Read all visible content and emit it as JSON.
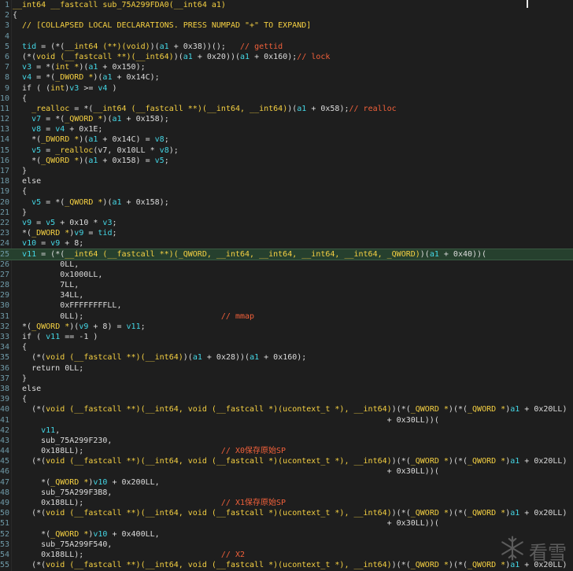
{
  "watermark": {
    "text": "看雪",
    "icon": "snowflake-icon"
  },
  "lines": [
    {
      "n": "1",
      "segs": [
        [
          "k",
          "__int64 __fastcall sub_75A299FDA0(__int64 a1)"
        ]
      ]
    },
    {
      "n": "2",
      "segs": [
        [
          "t",
          "{"
        ]
      ]
    },
    {
      "n": "3",
      "segs": [
        [
          "k",
          "  // [COLLAPSED LOCAL DECLARATIONS. PRESS NUMPAD \"+\" TO EXPAND]"
        ]
      ]
    },
    {
      "n": "4",
      "segs": [
        [
          "t",
          ""
        ]
      ]
    },
    {
      "n": "5",
      "segs": [
        [
          "t",
          "  "
        ],
        [
          "v",
          "tid"
        ],
        [
          "t",
          " = (*("
        ],
        [
          "k",
          "__int64 (**)(void)"
        ],
        [
          "t",
          ")("
        ],
        [
          "v",
          "a1"
        ],
        [
          "t",
          " + 0x38))();   "
        ],
        [
          "c",
          "// gettid"
        ]
      ]
    },
    {
      "n": "6",
      "segs": [
        [
          "t",
          "  (*("
        ],
        [
          "k",
          "void (__fastcall **)(__int64)"
        ],
        [
          "t",
          ")("
        ],
        [
          "v",
          "a1"
        ],
        [
          "t",
          " + 0x20))("
        ],
        [
          "v",
          "a1"
        ],
        [
          "t",
          " + 0x160);"
        ],
        [
          "c",
          "// lock"
        ]
      ]
    },
    {
      "n": "7",
      "segs": [
        [
          "t",
          "  "
        ],
        [
          "v",
          "v3"
        ],
        [
          "t",
          " = *("
        ],
        [
          "k",
          "int *"
        ],
        [
          "t",
          ")("
        ],
        [
          "v",
          "a1"
        ],
        [
          "t",
          " + 0x150);"
        ]
      ]
    },
    {
      "n": "8",
      "segs": [
        [
          "t",
          "  "
        ],
        [
          "v",
          "v4"
        ],
        [
          "t",
          " = *("
        ],
        [
          "k",
          "_DWORD *"
        ],
        [
          "t",
          ")("
        ],
        [
          "v",
          "a1"
        ],
        [
          "t",
          " + 0x14C);"
        ]
      ]
    },
    {
      "n": "9",
      "segs": [
        [
          "t",
          "  if ( ("
        ],
        [
          "k",
          "int"
        ],
        [
          "t",
          ")"
        ],
        [
          "v",
          "v3"
        ],
        [
          "t",
          " >= "
        ],
        [
          "v",
          "v4"
        ],
        [
          "t",
          " )"
        ]
      ]
    },
    {
      "n": "10",
      "segs": [
        [
          "t",
          "  {"
        ]
      ]
    },
    {
      "n": "11",
      "segs": [
        [
          "t",
          "    "
        ],
        [
          "k",
          "_realloc"
        ],
        [
          "t",
          " = *("
        ],
        [
          "k",
          "__int64 (__fastcall **)(__int64, __int64)"
        ],
        [
          "t",
          ")("
        ],
        [
          "v",
          "a1"
        ],
        [
          "t",
          " + 0x58);"
        ],
        [
          "c",
          "// realloc"
        ]
      ]
    },
    {
      "n": "12",
      "segs": [
        [
          "t",
          "    "
        ],
        [
          "v",
          "v7"
        ],
        [
          "t",
          " = *("
        ],
        [
          "k",
          "_QWORD *"
        ],
        [
          "t",
          ")("
        ],
        [
          "v",
          "a1"
        ],
        [
          "t",
          " + 0x158);"
        ]
      ]
    },
    {
      "n": "13",
      "segs": [
        [
          "t",
          "    "
        ],
        [
          "v",
          "v8"
        ],
        [
          "t",
          " = "
        ],
        [
          "v",
          "v4"
        ],
        [
          "t",
          " + 0x1E;"
        ]
      ]
    },
    {
      "n": "14",
      "segs": [
        [
          "t",
          "    *("
        ],
        [
          "k",
          "_DWORD *"
        ],
        [
          "t",
          ")("
        ],
        [
          "v",
          "a1"
        ],
        [
          "t",
          " + 0x14C) = "
        ],
        [
          "v",
          "v8"
        ],
        [
          "t",
          ";"
        ]
      ]
    },
    {
      "n": "15",
      "segs": [
        [
          "t",
          "    "
        ],
        [
          "v",
          "v5"
        ],
        [
          "t",
          " = "
        ],
        [
          "k",
          "_realloc"
        ],
        [
          "t",
          "(v7, 0x10LL * "
        ],
        [
          "v",
          "v8"
        ],
        [
          "t",
          ");"
        ]
      ]
    },
    {
      "n": "16",
      "segs": [
        [
          "t",
          "    *("
        ],
        [
          "k",
          "_QWORD *"
        ],
        [
          "t",
          ")("
        ],
        [
          "v",
          "a1"
        ],
        [
          "t",
          " + 0x158) = "
        ],
        [
          "v",
          "v5"
        ],
        [
          "t",
          ";"
        ]
      ]
    },
    {
      "n": "17",
      "segs": [
        [
          "t",
          "  }"
        ]
      ]
    },
    {
      "n": "18",
      "segs": [
        [
          "t",
          "  else"
        ]
      ]
    },
    {
      "n": "19",
      "segs": [
        [
          "t",
          "  {"
        ]
      ]
    },
    {
      "n": "20",
      "segs": [
        [
          "t",
          "    "
        ],
        [
          "v",
          "v5"
        ],
        [
          "t",
          " = *("
        ],
        [
          "k",
          "_QWORD *"
        ],
        [
          "t",
          ")("
        ],
        [
          "v",
          "a1"
        ],
        [
          "t",
          " + 0x158);"
        ]
      ]
    },
    {
      "n": "21",
      "segs": [
        [
          "t",
          "  }"
        ]
      ]
    },
    {
      "n": "22",
      "segs": [
        [
          "t",
          "  "
        ],
        [
          "v",
          "v9"
        ],
        [
          "t",
          " = "
        ],
        [
          "v",
          "v5"
        ],
        [
          "t",
          " + 0x10 * "
        ],
        [
          "v",
          "v3"
        ],
        [
          "t",
          ";"
        ]
      ]
    },
    {
      "n": "23",
      "segs": [
        [
          "t",
          "  *("
        ],
        [
          "k",
          "_DWORD *"
        ],
        [
          "t",
          ")"
        ],
        [
          "v",
          "v9"
        ],
        [
          "t",
          " = "
        ],
        [
          "v",
          "tid"
        ],
        [
          "t",
          ";"
        ]
      ]
    },
    {
      "n": "24",
      "segs": [
        [
          "t",
          "  "
        ],
        [
          "v",
          "v10"
        ],
        [
          "t",
          " = "
        ],
        [
          "v",
          "v9"
        ],
        [
          "t",
          " + 8;"
        ]
      ]
    },
    {
      "n": "25",
      "hl": true,
      "segs": [
        [
          "t",
          "  "
        ],
        [
          "v",
          "v11"
        ],
        [
          "t",
          " = (*("
        ],
        [
          "k",
          "__int64 (__fastcall **)(_QWORD, __int64, __int64, __int64, __int64, _QWORD)"
        ],
        [
          "t",
          ")("
        ],
        [
          "v",
          "a1"
        ],
        [
          "t",
          " + 0x40))("
        ]
      ]
    },
    {
      "n": "26",
      "segs": [
        [
          "t",
          "          0LL,"
        ]
      ]
    },
    {
      "n": "27",
      "segs": [
        [
          "t",
          "          0x1000LL,"
        ]
      ]
    },
    {
      "n": "28",
      "segs": [
        [
          "t",
          "          7LL,"
        ]
      ]
    },
    {
      "n": "29",
      "segs": [
        [
          "t",
          "          34LL,"
        ]
      ]
    },
    {
      "n": "30",
      "segs": [
        [
          "t",
          "          0xFFFFFFFFLL,"
        ]
      ]
    },
    {
      "n": "31",
      "segs": [
        [
          "t",
          "          0LL);                             "
        ],
        [
          "c",
          "// mmap"
        ]
      ]
    },
    {
      "n": "32",
      "segs": [
        [
          "t",
          "  *("
        ],
        [
          "k",
          "_QWORD *"
        ],
        [
          "t",
          ")("
        ],
        [
          "v",
          "v9"
        ],
        [
          "t",
          " + 8) = "
        ],
        [
          "v",
          "v11"
        ],
        [
          "t",
          ";"
        ]
      ]
    },
    {
      "n": "33",
      "segs": [
        [
          "t",
          "  if ( "
        ],
        [
          "v",
          "v11"
        ],
        [
          "t",
          " == -1 )"
        ]
      ]
    },
    {
      "n": "34",
      "segs": [
        [
          "t",
          "  {"
        ]
      ]
    },
    {
      "n": "35",
      "segs": [
        [
          "t",
          "    (*("
        ],
        [
          "k",
          "void (__fastcall **)(__int64)"
        ],
        [
          "t",
          ")("
        ],
        [
          "v",
          "a1"
        ],
        [
          "t",
          " + 0x28))("
        ],
        [
          "v",
          "a1"
        ],
        [
          "t",
          " + 0x160);"
        ]
      ]
    },
    {
      "n": "36",
      "segs": [
        [
          "t",
          "    return 0LL;"
        ]
      ]
    },
    {
      "n": "37",
      "segs": [
        [
          "t",
          "  }"
        ]
      ]
    },
    {
      "n": "38",
      "segs": [
        [
          "t",
          "  else"
        ]
      ]
    },
    {
      "n": "39",
      "segs": [
        [
          "t",
          "  {"
        ]
      ]
    },
    {
      "n": "40",
      "segs": [
        [
          "t",
          "    (*("
        ],
        [
          "k",
          "void (__fastcall **)(__int64, void (__fastcall *)(ucontext_t *), __int64)"
        ],
        [
          "t",
          ")(*("
        ],
        [
          "k",
          "_QWORD *"
        ],
        [
          "t",
          ")(*("
        ],
        [
          "k",
          "_QWORD *"
        ],
        [
          "t",
          ")"
        ],
        [
          "v",
          "a1"
        ],
        [
          "t",
          " + 0x20LL)"
        ]
      ]
    },
    {
      "n": "41",
      "segs": [
        [
          "t",
          "                                                                               + 0x30LL))("
        ]
      ]
    },
    {
      "n": "42",
      "segs": [
        [
          "t",
          "      "
        ],
        [
          "v",
          "v11"
        ],
        [
          "t",
          ","
        ]
      ]
    },
    {
      "n": "43",
      "segs": [
        [
          "t",
          "      sub_75A299F230,"
        ]
      ]
    },
    {
      "n": "44",
      "segs": [
        [
          "t",
          "      0x188LL);                             "
        ],
        [
          "c",
          "// X0保存原始SP"
        ]
      ]
    },
    {
      "n": "45",
      "segs": [
        [
          "t",
          "    (*("
        ],
        [
          "k",
          "void (__fastcall **)(__int64, void (__fastcall *)(ucontext_t *), __int64)"
        ],
        [
          "t",
          ")(*("
        ],
        [
          "k",
          "_QWORD *"
        ],
        [
          "t",
          ")(*("
        ],
        [
          "k",
          "_QWORD *"
        ],
        [
          "t",
          ")"
        ],
        [
          "v",
          "a1"
        ],
        [
          "t",
          " + 0x20LL)"
        ]
      ]
    },
    {
      "n": "46",
      "segs": [
        [
          "t",
          "                                                                               + 0x30LL))("
        ]
      ]
    },
    {
      "n": "47",
      "segs": [
        [
          "t",
          "      *("
        ],
        [
          "k",
          "_QWORD *"
        ],
        [
          "t",
          ")"
        ],
        [
          "v",
          "v10"
        ],
        [
          "t",
          " + 0x200LL,"
        ]
      ]
    },
    {
      "n": "48",
      "segs": [
        [
          "t",
          "      sub_75A299F3B8,"
        ]
      ]
    },
    {
      "n": "49",
      "segs": [
        [
          "t",
          "      0x188LL);                             "
        ],
        [
          "c",
          "// X1保存原始SP"
        ]
      ]
    },
    {
      "n": "50",
      "segs": [
        [
          "t",
          "    (*("
        ],
        [
          "k",
          "void (__fastcall **)(__int64, void (__fastcall *)(ucontext_t *), __int64)"
        ],
        [
          "t",
          ")(*("
        ],
        [
          "k",
          "_QWORD *"
        ],
        [
          "t",
          ")(*("
        ],
        [
          "k",
          "_QWORD *"
        ],
        [
          "t",
          ")"
        ],
        [
          "v",
          "a1"
        ],
        [
          "t",
          " + 0x20LL)"
        ]
      ]
    },
    {
      "n": "51",
      "segs": [
        [
          "t",
          "                                                                               + 0x30LL))("
        ]
      ]
    },
    {
      "n": "52",
      "segs": [
        [
          "t",
          "      *("
        ],
        [
          "k",
          "_QWORD *"
        ],
        [
          "t",
          ")"
        ],
        [
          "v",
          "v10"
        ],
        [
          "t",
          " + 0x400LL,"
        ]
      ]
    },
    {
      "n": "53",
      "segs": [
        [
          "t",
          "      sub_75A299F540,"
        ]
      ]
    },
    {
      "n": "54",
      "segs": [
        [
          "t",
          "      0x188LL);                             "
        ],
        [
          "c",
          "// X2"
        ]
      ]
    },
    {
      "n": "55",
      "segs": [
        [
          "t",
          "    (*("
        ],
        [
          "k",
          "void (__fastcall **)(__int64, void (__fastcall *)(ucontext_t *), __int64)"
        ],
        [
          "t",
          ")(*("
        ],
        [
          "k",
          "_QWORD *"
        ],
        [
          "t",
          ")(*("
        ],
        [
          "k",
          "_QWORD *"
        ],
        [
          "t",
          ")"
        ],
        [
          "v",
          "a1"
        ],
        [
          "t",
          " + 0x20LL)"
        ]
      ]
    }
  ]
}
